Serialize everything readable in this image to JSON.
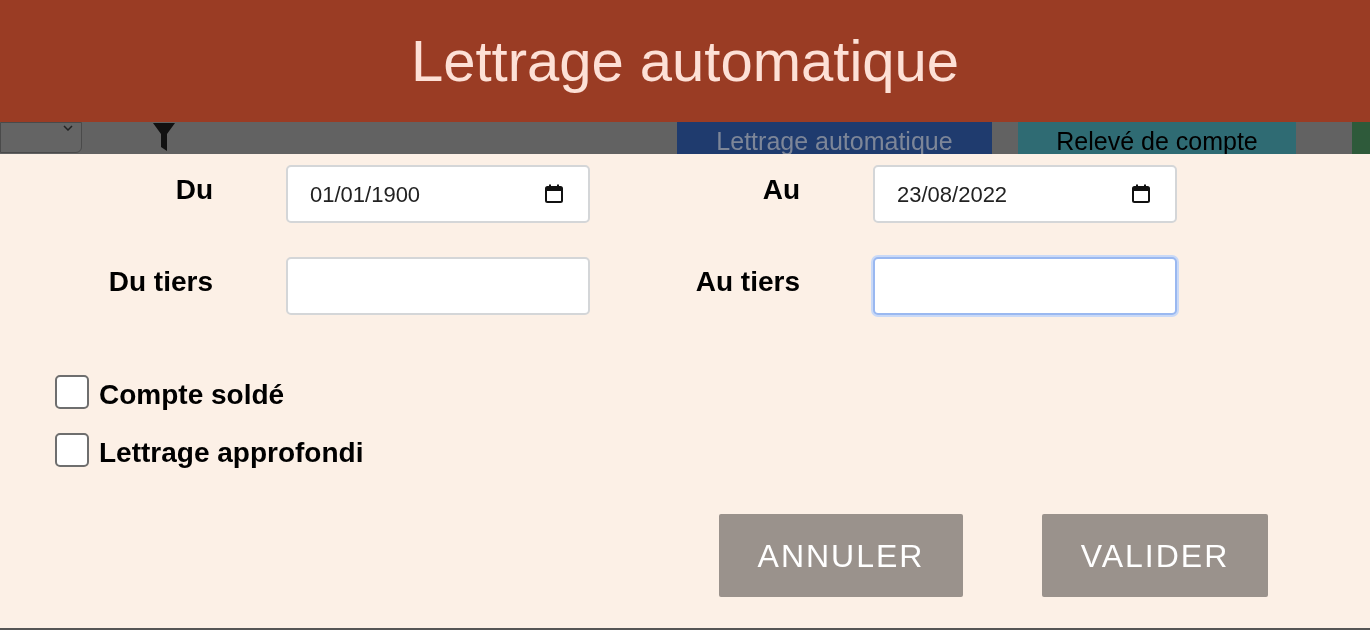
{
  "header": {
    "title": "Lettrage automatique"
  },
  "background_toolbar": {
    "buttons": [
      {
        "label": "Lettrage automatique",
        "kind": "primary"
      },
      {
        "label": "Relevé de compte",
        "kind": "secondary"
      }
    ]
  },
  "fields": [
    {
      "label": "Du",
      "kind": "date",
      "value": "01/01/1900",
      "focused": false
    },
    {
      "label": "Au",
      "kind": "date",
      "value": "23/08/2022",
      "focused": false
    },
    {
      "label": "Du tiers",
      "kind": "text",
      "focused": false
    },
    {
      "label": "Au tiers",
      "kind": "text",
      "focused": true
    }
  ],
  "checkboxes": [
    {
      "label": "Compte soldé",
      "checked": false
    },
    {
      "label": "Lettrage approfondi",
      "checked": false
    }
  ],
  "buttons": [
    "ANNULER",
    "VALIDER"
  ]
}
